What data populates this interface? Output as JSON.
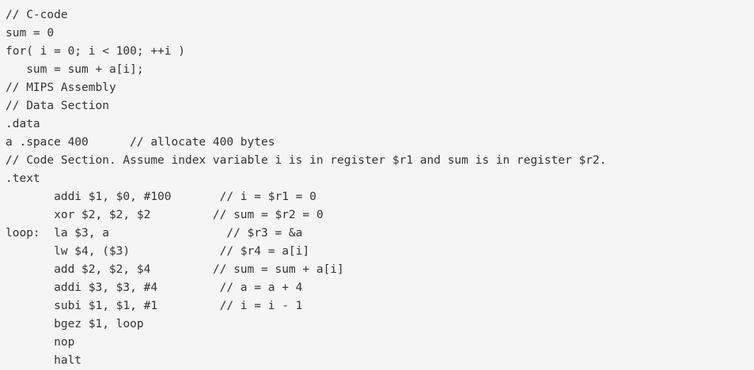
{
  "code": {
    "lines": [
      "// C-code",
      "sum = 0",
      "for( i = 0; i < 100; ++i )",
      "   sum = sum + a[i];",
      "// MIPS Assembly",
      "// Data Section",
      ".data",
      "a .space 400      // allocate 400 bytes",
      "// Code Section. Assume index variable i is in register $r1 and sum is in register $r2.",
      ".text",
      "       addi $1, $0, #100       // i = $r1 = 0",
      "       xor $2, $2, $2         // sum = $r2 = 0",
      "loop:  la $3, a                 // $r3 = &a",
      "       lw $4, ($3)             // $r4 = a[i]",
      "       add $2, $2, $4         // sum = sum + a[i]",
      "       addi $3, $3, #4         // a = a + 4",
      "       subi $1, $1, #1         // i = i - 1",
      "       bgez $1, loop",
      "       nop",
      "       halt"
    ]
  }
}
